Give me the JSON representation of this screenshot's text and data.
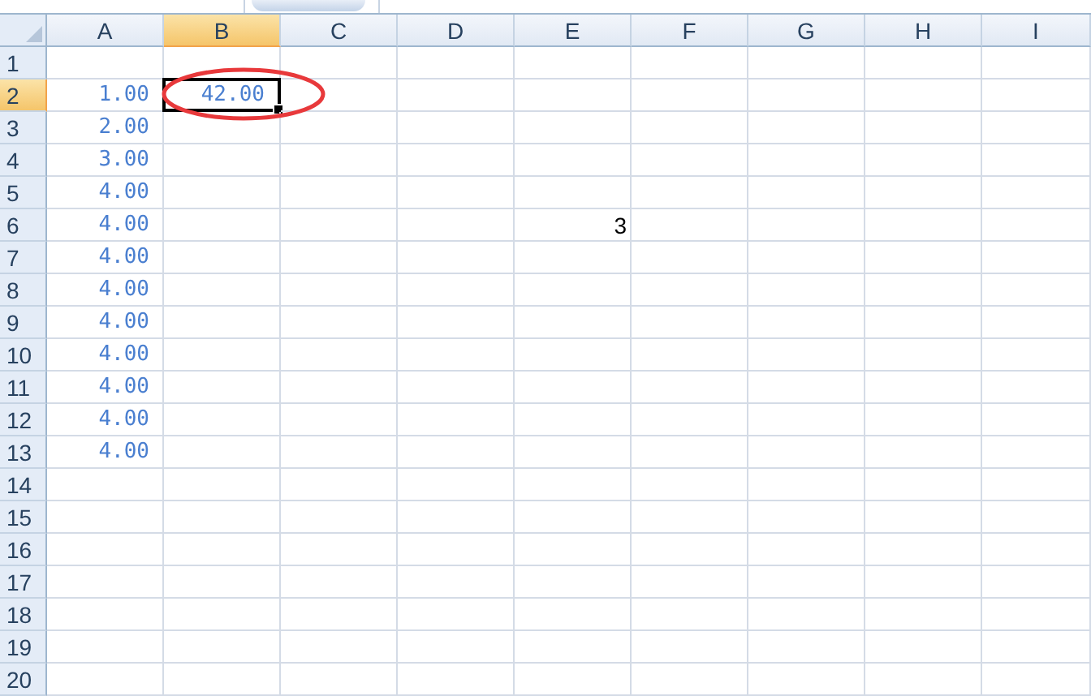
{
  "columns": [
    {
      "label": "A",
      "selected": false
    },
    {
      "label": "B",
      "selected": true
    },
    {
      "label": "C",
      "selected": false
    },
    {
      "label": "D",
      "selected": false
    },
    {
      "label": "E",
      "selected": false
    },
    {
      "label": "F",
      "selected": false
    },
    {
      "label": "G",
      "selected": false
    },
    {
      "label": "H",
      "selected": false
    },
    {
      "label": "I",
      "selected": false
    }
  ],
  "rows": [
    {
      "label": "1",
      "selected": false,
      "cells": [
        {
          "selected": false
        },
        {
          "selected": false
        },
        {
          "selected": false
        },
        {
          "selected": false
        },
        {
          "selected": false
        },
        {
          "selected": false
        },
        {
          "selected": false
        },
        {
          "selected": false
        },
        {
          "selected": false
        }
      ]
    },
    {
      "label": "2",
      "selected": true,
      "cells": [
        {
          "value": "1.00",
          "kind": "formatted",
          "selected": false
        },
        {
          "value": "42.00",
          "kind": "formatted",
          "selected": true
        },
        {
          "selected": false
        },
        {
          "selected": false
        },
        {
          "selected": false
        },
        {
          "selected": false
        },
        {
          "selected": false
        },
        {
          "selected": false
        },
        {
          "selected": false
        }
      ]
    },
    {
      "label": "3",
      "selected": false,
      "cells": [
        {
          "value": "2.00",
          "kind": "formatted",
          "selected": false
        },
        {
          "selected": false
        },
        {
          "selected": false
        },
        {
          "selected": false
        },
        {
          "selected": false
        },
        {
          "selected": false
        },
        {
          "selected": false
        },
        {
          "selected": false
        },
        {
          "selected": false
        }
      ]
    },
    {
      "label": "4",
      "selected": false,
      "cells": [
        {
          "value": "3.00",
          "kind": "formatted",
          "selected": false
        },
        {
          "selected": false
        },
        {
          "selected": false
        },
        {
          "selected": false
        },
        {
          "selected": false
        },
        {
          "selected": false
        },
        {
          "selected": false
        },
        {
          "selected": false
        },
        {
          "selected": false
        }
      ]
    },
    {
      "label": "5",
      "selected": false,
      "cells": [
        {
          "value": "4.00",
          "kind": "formatted",
          "selected": false
        },
        {
          "selected": false
        },
        {
          "selected": false
        },
        {
          "selected": false
        },
        {
          "selected": false
        },
        {
          "selected": false
        },
        {
          "selected": false
        },
        {
          "selected": false
        },
        {
          "selected": false
        }
      ]
    },
    {
      "label": "6",
      "selected": false,
      "cells": [
        {
          "value": "4.00",
          "kind": "formatted",
          "selected": false
        },
        {
          "selected": false
        },
        {
          "selected": false
        },
        {
          "selected": false
        },
        {
          "value": "3",
          "kind": "plain",
          "selected": false
        },
        {
          "selected": false
        },
        {
          "selected": false
        },
        {
          "selected": false
        },
        {
          "selected": false
        }
      ]
    },
    {
      "label": "7",
      "selected": false,
      "cells": [
        {
          "value": "4.00",
          "kind": "formatted",
          "selected": false
        },
        {
          "selected": false
        },
        {
          "selected": false
        },
        {
          "selected": false
        },
        {
          "selected": false
        },
        {
          "selected": false
        },
        {
          "selected": false
        },
        {
          "selected": false
        },
        {
          "selected": false
        }
      ]
    },
    {
      "label": "8",
      "selected": false,
      "cells": [
        {
          "value": "4.00",
          "kind": "formatted",
          "selected": false
        },
        {
          "selected": false
        },
        {
          "selected": false
        },
        {
          "selected": false
        },
        {
          "selected": false
        },
        {
          "selected": false
        },
        {
          "selected": false
        },
        {
          "selected": false
        },
        {
          "selected": false
        }
      ]
    },
    {
      "label": "9",
      "selected": false,
      "cells": [
        {
          "value": "4.00",
          "kind": "formatted",
          "selected": false
        },
        {
          "selected": false
        },
        {
          "selected": false
        },
        {
          "selected": false
        },
        {
          "selected": false
        },
        {
          "selected": false
        },
        {
          "selected": false
        },
        {
          "selected": false
        },
        {
          "selected": false
        }
      ]
    },
    {
      "label": "10",
      "selected": false,
      "cells": [
        {
          "value": "4.00",
          "kind": "formatted",
          "selected": false
        },
        {
          "selected": false
        },
        {
          "selected": false
        },
        {
          "selected": false
        },
        {
          "selected": false
        },
        {
          "selected": false
        },
        {
          "selected": false
        },
        {
          "selected": false
        },
        {
          "selected": false
        }
      ]
    },
    {
      "label": "11",
      "selected": false,
      "cells": [
        {
          "value": "4.00",
          "kind": "formatted",
          "selected": false
        },
        {
          "selected": false
        },
        {
          "selected": false
        },
        {
          "selected": false
        },
        {
          "selected": false
        },
        {
          "selected": false
        },
        {
          "selected": false
        },
        {
          "selected": false
        },
        {
          "selected": false
        }
      ]
    },
    {
      "label": "12",
      "selected": false,
      "cells": [
        {
          "value": "4.00",
          "kind": "formatted",
          "selected": false
        },
        {
          "selected": false
        },
        {
          "selected": false
        },
        {
          "selected": false
        },
        {
          "selected": false
        },
        {
          "selected": false
        },
        {
          "selected": false
        },
        {
          "selected": false
        },
        {
          "selected": false
        }
      ]
    },
    {
      "label": "13",
      "selected": false,
      "cells": [
        {
          "value": "4.00",
          "kind": "formatted",
          "selected": false
        },
        {
          "selected": false
        },
        {
          "selected": false
        },
        {
          "selected": false
        },
        {
          "selected": false
        },
        {
          "selected": false
        },
        {
          "selected": false
        },
        {
          "selected": false
        },
        {
          "selected": false
        }
      ]
    },
    {
      "label": "14",
      "selected": false,
      "cells": [
        {
          "selected": false
        },
        {
          "selected": false
        },
        {
          "selected": false
        },
        {
          "selected": false
        },
        {
          "selected": false
        },
        {
          "selected": false
        },
        {
          "selected": false
        },
        {
          "selected": false
        },
        {
          "selected": false
        }
      ]
    },
    {
      "label": "15",
      "selected": false,
      "cells": [
        {
          "selected": false
        },
        {
          "selected": false
        },
        {
          "selected": false
        },
        {
          "selected": false
        },
        {
          "selected": false
        },
        {
          "selected": false
        },
        {
          "selected": false
        },
        {
          "selected": false
        },
        {
          "selected": false
        }
      ]
    },
    {
      "label": "16",
      "selected": false,
      "cells": [
        {
          "selected": false
        },
        {
          "selected": false
        },
        {
          "selected": false
        },
        {
          "selected": false
        },
        {
          "selected": false
        },
        {
          "selected": false
        },
        {
          "selected": false
        },
        {
          "selected": false
        },
        {
          "selected": false
        }
      ]
    },
    {
      "label": "17",
      "selected": false,
      "cells": [
        {
          "selected": false
        },
        {
          "selected": false
        },
        {
          "selected": false
        },
        {
          "selected": false
        },
        {
          "selected": false
        },
        {
          "selected": false
        },
        {
          "selected": false
        },
        {
          "selected": false
        },
        {
          "selected": false
        }
      ]
    },
    {
      "label": "18",
      "selected": false,
      "cells": [
        {
          "selected": false
        },
        {
          "selected": false
        },
        {
          "selected": false
        },
        {
          "selected": false
        },
        {
          "selected": false
        },
        {
          "selected": false
        },
        {
          "selected": false
        },
        {
          "selected": false
        },
        {
          "selected": false
        }
      ]
    },
    {
      "label": "19",
      "selected": false,
      "cells": [
        {
          "selected": false
        },
        {
          "selected": false
        },
        {
          "selected": false
        },
        {
          "selected": false
        },
        {
          "selected": false
        },
        {
          "selected": false
        },
        {
          "selected": false
        },
        {
          "selected": false
        },
        {
          "selected": false
        }
      ]
    },
    {
      "label": "20",
      "selected": false,
      "cells": [
        {
          "selected": false
        },
        {
          "selected": false
        },
        {
          "selected": false
        },
        {
          "selected": false
        },
        {
          "selected": false
        },
        {
          "selected": false
        },
        {
          "selected": false
        },
        {
          "selected": false
        },
        {
          "selected": false
        }
      ]
    }
  ]
}
